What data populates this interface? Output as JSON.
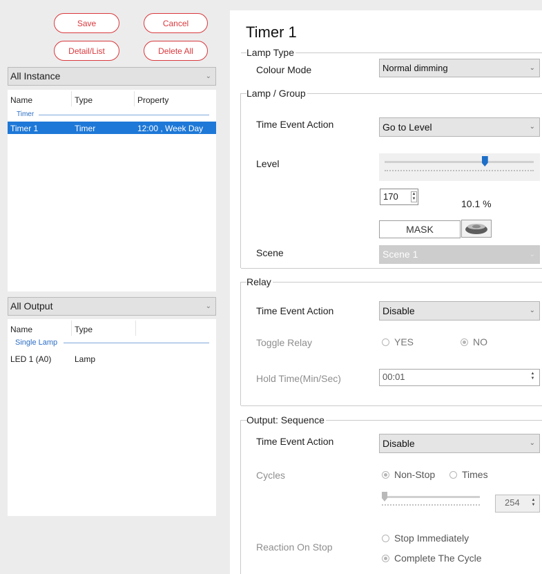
{
  "toolbar": {
    "save_label": "Save",
    "cancel_label": "Cancel",
    "detail_list_label": "Detail/List",
    "delete_all_label": "Delete All"
  },
  "instance_list": {
    "filter": "All Instance",
    "columns": [
      "Name",
      "Type",
      "Property"
    ],
    "group": "Timer",
    "rows": [
      {
        "name": "Timer 1",
        "type": "Timer",
        "property": "12:00 , Week Day",
        "selected": true
      }
    ]
  },
  "output_list": {
    "filter": "All Output",
    "columns": [
      "Name",
      "Type"
    ],
    "group": "Single Lamp",
    "rows": [
      {
        "name": "LED 1 (A0)",
        "type": "Lamp"
      }
    ]
  },
  "detail": {
    "title": "Timer 1",
    "lamp_type": {
      "heading": "Lamp Type",
      "colour_mode_label": "Colour Mode",
      "colour_mode_value": "Normal dimming"
    },
    "lamp_group": {
      "heading": "Lamp / Group",
      "action_label": "Time Event Action",
      "action_value": "Go to Level",
      "level_label": "Level",
      "level_value": "170",
      "level_percent": "10.1 %",
      "slider_fraction": 0.67,
      "mask_label": "MASK",
      "scene_label": "Scene",
      "scene_value": "Scene 1"
    },
    "relay": {
      "heading": "Relay",
      "action_label": "Time Event Action",
      "action_value": "Disable",
      "toggle_label": "Toggle Relay",
      "yes_label": "YES",
      "no_label": "NO",
      "selected": "NO",
      "hold_label": "Hold Time(Min/Sec)",
      "hold_value": "00:01"
    },
    "sequence": {
      "heading": "Output: Sequence",
      "action_label": "Time Event Action",
      "action_value": "Disable",
      "cycles_label": "Cycles",
      "non_stop_label": "Non-Stop",
      "times_label": "Times",
      "cycles_selected": "Non-Stop",
      "times_value": "254",
      "slider_fraction": 0.0,
      "reaction_label": "Reaction On Stop",
      "stop_label": "Stop Immediately",
      "complete_label": "Complete The Cycle",
      "reaction_selected": "Complete The Cycle"
    }
  },
  "colors": {
    "accent_red": "#d9383d",
    "selection_blue": "#1e78d7",
    "group_blue": "#2a6cc4",
    "slider_thumb": "#1e6fc8"
  }
}
